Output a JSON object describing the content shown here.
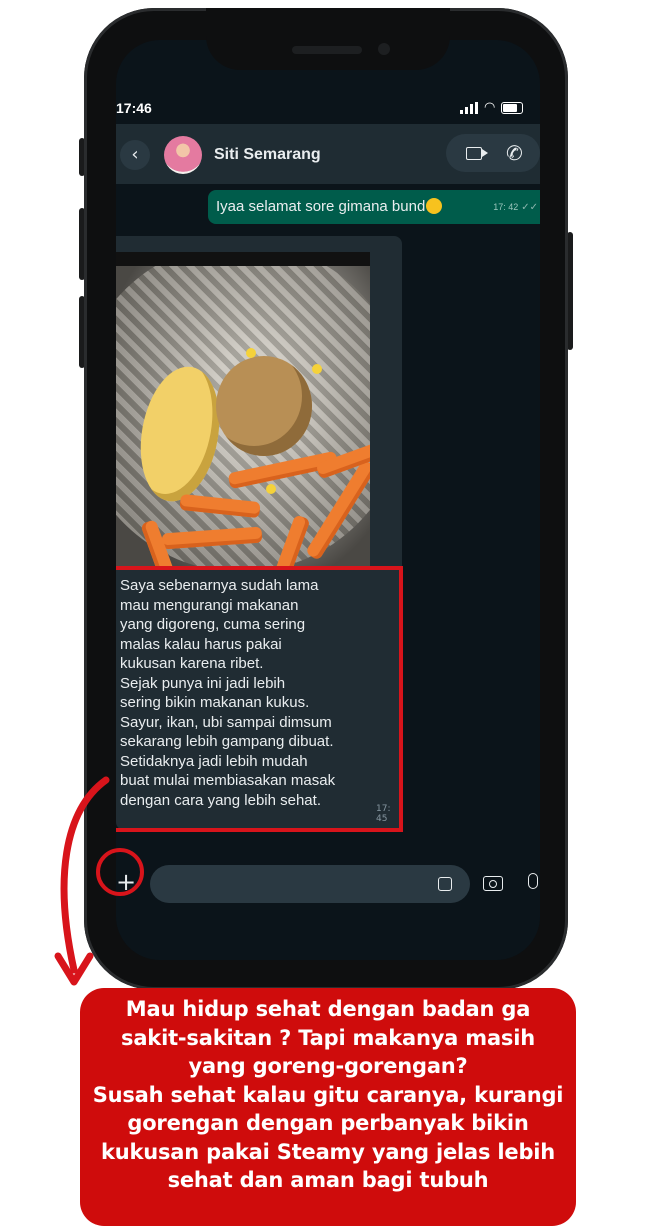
{
  "status_bar": {
    "time": "17:46"
  },
  "chat_header": {
    "contact_name": "Siti Semarang"
  },
  "messages": [
    {
      "direction": "outgoing",
      "text": "Iyaa selamat sore gimana bund",
      "emoji": "smiling-face",
      "time": "17: 42"
    },
    {
      "direction": "incoming",
      "has_photo": true,
      "text": "Saya sebenarnya sudah lama\nmau mengurangi makanan\nyang digoreng, cuma sering\nmalas kalau harus pakai\nkukusan karena ribet.\nSejak punya ini jadi lebih\nsering bikin makanan kukus.\nSayur, ikan, ubi sampai dimsum\nsekarang lebih gampang dibuat.\nSetidaknya jadi lebih mudah\nbuat mulai membiasakan masak\ndengan cara yang lebih sehat.",
      "time": "17: 45"
    }
  ],
  "promo": {
    "text": "Mau hidup sehat dengan badan ga\nsakit-sakitan ? Tapi makanya masih\nyang goreng-gorengan?\nSusah sehat kalau gitu caranya, kurangi\ngorengan dengan perbanyak bikin\nkukusan pakai Steamy yang jelas lebih\nsehat dan aman bagi tubuh"
  },
  "colors": {
    "chat_background": "#0b141a",
    "outgoing_bubble": "#005c4b",
    "incoming_bubble": "#202c33",
    "accent_red": "#cf0c0c"
  }
}
